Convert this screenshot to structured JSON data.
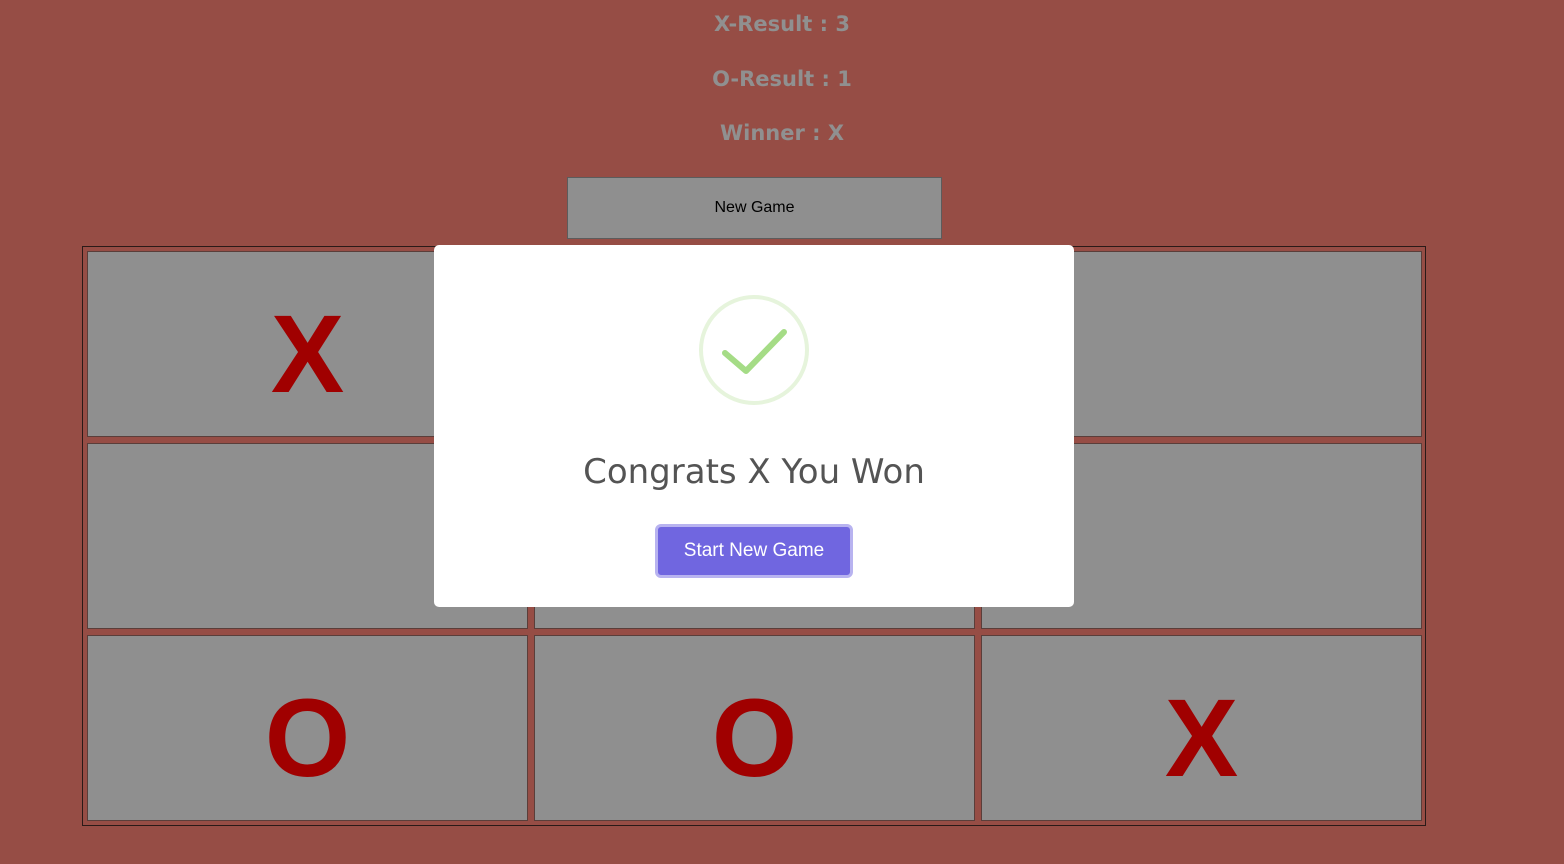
{
  "scoreboard": {
    "x_result": "X-Result : 3",
    "o_result": "O-Result : 1",
    "winner": "Winner : X"
  },
  "toolbar": {
    "new_game_label": "New Game"
  },
  "board": {
    "cells": [
      "X",
      "",
      "",
      "",
      "",
      "",
      "O",
      "O",
      "X"
    ],
    "mark_color": "#a00000",
    "cell_color": "#8f8f8f"
  },
  "modal": {
    "icon": "success-check-icon",
    "title": "Congrats X You Won",
    "confirm_label": "Start New Game",
    "accent": "#7066e0",
    "icon_color": "#a5dc86"
  },
  "colors": {
    "background": "#964d45"
  }
}
